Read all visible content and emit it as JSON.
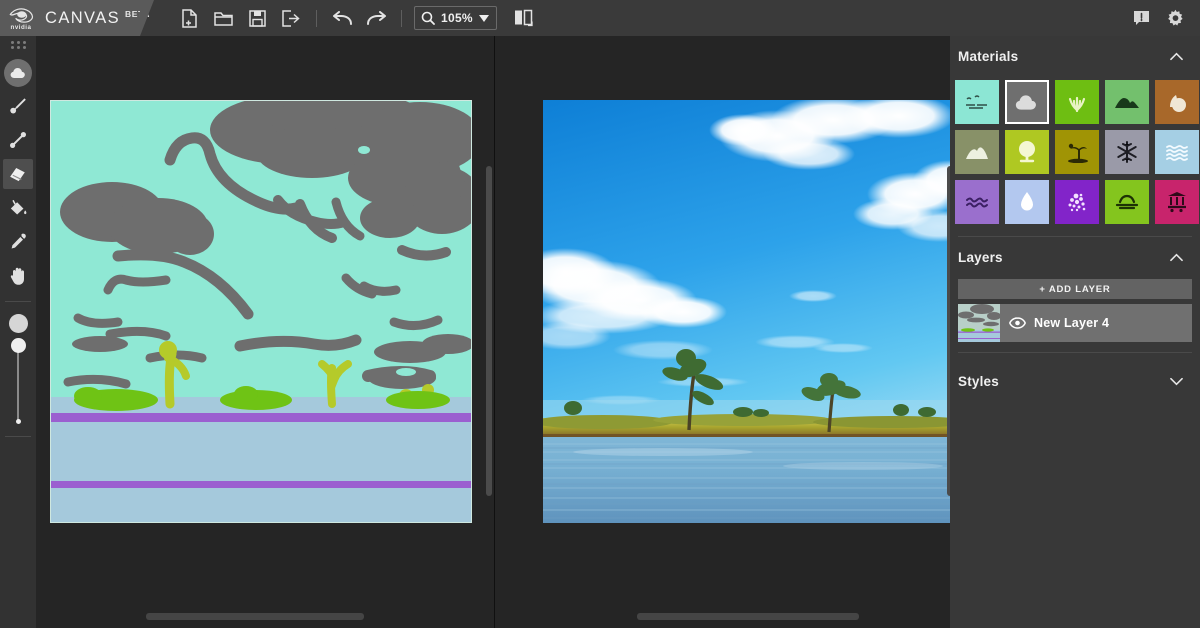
{
  "app": {
    "brand_name": "CANVAS",
    "brand_badge": "BETA",
    "vendor": "nvidia"
  },
  "toolbar": {
    "items": [
      {
        "name": "new-file-button",
        "icon": "new-file-icon",
        "label": "New"
      },
      {
        "name": "open-file-button",
        "icon": "open-folder-icon",
        "label": "Open"
      },
      {
        "name": "save-button",
        "icon": "save-disk-icon",
        "label": "Save"
      },
      {
        "name": "export-button",
        "icon": "export-icon",
        "label": "Export"
      },
      {
        "name": "undo-button",
        "icon": "undo-arrow-icon",
        "label": "Undo"
      },
      {
        "name": "redo-button",
        "icon": "redo-arrow-icon",
        "label": "Redo"
      }
    ],
    "zoom": {
      "value": "105%",
      "icon": "magnifier-icon",
      "caret": "chevron-down-icon"
    },
    "view_toggle": {
      "name": "split-view-button",
      "icon": "split-view-icon"
    },
    "feedback": {
      "name": "feedback-button",
      "icon": "comment-alert-icon"
    },
    "settings": {
      "name": "settings-button",
      "icon": "gear-icon"
    }
  },
  "left_toolbar": {
    "drag_handle": "drag-grip-icon",
    "active_material_swatch": {
      "icon": "cloud-icon",
      "color": "#6f6f6f"
    },
    "tools": [
      {
        "name": "paintbrush-tool",
        "icon": "paintbrush-icon",
        "active": false
      },
      {
        "name": "line-tool",
        "icon": "line-icon",
        "active": false
      },
      {
        "name": "eraser-tool",
        "icon": "eraser-icon",
        "active": true
      },
      {
        "name": "fill-tool",
        "icon": "paint-bucket-icon",
        "active": false
      },
      {
        "name": "eyedropper-tool",
        "icon": "eyedropper-icon",
        "active": false
      },
      {
        "name": "pan-tool",
        "icon": "hand-icon",
        "active": false
      }
    ],
    "brush_size_slider": {
      "name": "brush-size-slider",
      "preview": "brush-size-preview"
    }
  },
  "canvas": {
    "left_pane_name": "segmentation-canvas",
    "right_pane_name": "rendered-output-canvas",
    "colors": {
      "sky": "#8fe8d4",
      "cloud": "#6e6e6e",
      "water": "#a5c9dc",
      "river": "#9b5fd0",
      "grass": "#6fc315",
      "bush": "#b5ca2a"
    }
  },
  "materials_panel": {
    "title": "Materials",
    "collapse_icon": "chevron-up-icon",
    "items": [
      {
        "name": "material-sky",
        "icon": "birds-sky-icon",
        "color": "#8ce6d4",
        "fg": "#2f4f46",
        "selected": false
      },
      {
        "name": "material-cloud",
        "icon": "cloud-icon",
        "color": "#6f6f6f",
        "fg": "#dcdcdc",
        "selected": true
      },
      {
        "name": "material-grass",
        "icon": "grass-icon",
        "color": "#6ebe12",
        "fg": "#e9f3c4",
        "selected": false
      },
      {
        "name": "material-hill",
        "icon": "hill-icon",
        "color": "#73c06d",
        "fg": "#18391a",
        "selected": false
      },
      {
        "name": "material-rock",
        "icon": "rock-icon",
        "color": "#a8682a",
        "fg": "#f0e7d5",
        "selected": false
      },
      {
        "name": "material-mountain",
        "icon": "mountain-icon",
        "color": "#889168",
        "fg": "#edf0e0",
        "selected": false
      },
      {
        "name": "material-bush",
        "icon": "bush-tree-icon",
        "color": "#afc822",
        "fg": "#f4f7d2",
        "selected": false
      },
      {
        "name": "material-island",
        "icon": "palm-island-icon",
        "color": "#a09405",
        "fg": "#2c2a05",
        "selected": false
      },
      {
        "name": "material-snow",
        "icon": "snowflake-icon",
        "color": "#9a9aa8",
        "fg": "#1d1d24",
        "selected": false
      },
      {
        "name": "material-sea",
        "icon": "sea-waves-icon",
        "color": "#a5cfe4",
        "fg": "#f4fbff",
        "selected": false
      },
      {
        "name": "material-river",
        "icon": "river-waves-icon",
        "color": "#9a6fcd",
        "fg": "#3b1f63",
        "selected": false
      },
      {
        "name": "material-water",
        "icon": "water-drop-icon",
        "color": "#b3c8ef",
        "fg": "#ffffff",
        "selected": false
      },
      {
        "name": "material-flowers",
        "icon": "flower-dots-icon",
        "color": "#8224c9",
        "fg": "#f2e1ff",
        "selected": false
      },
      {
        "name": "material-fog",
        "icon": "fog-icon",
        "color": "#84c51e",
        "fg": "#1d3205",
        "selected": false
      },
      {
        "name": "material-ruins",
        "icon": "ruins-icon",
        "color": "#c8246c",
        "fg": "#2e0a19",
        "selected": false
      }
    ]
  },
  "layers_panel": {
    "title": "Layers",
    "collapse_icon": "chevron-up-icon",
    "add_layer_label": "+ ADD LAYER",
    "layers": [
      {
        "name": "New Layer 4",
        "visible": true,
        "visibility_icon": "eye-icon"
      }
    ]
  },
  "styles_panel": {
    "title": "Styles",
    "expand_icon": "chevron-down-icon"
  }
}
